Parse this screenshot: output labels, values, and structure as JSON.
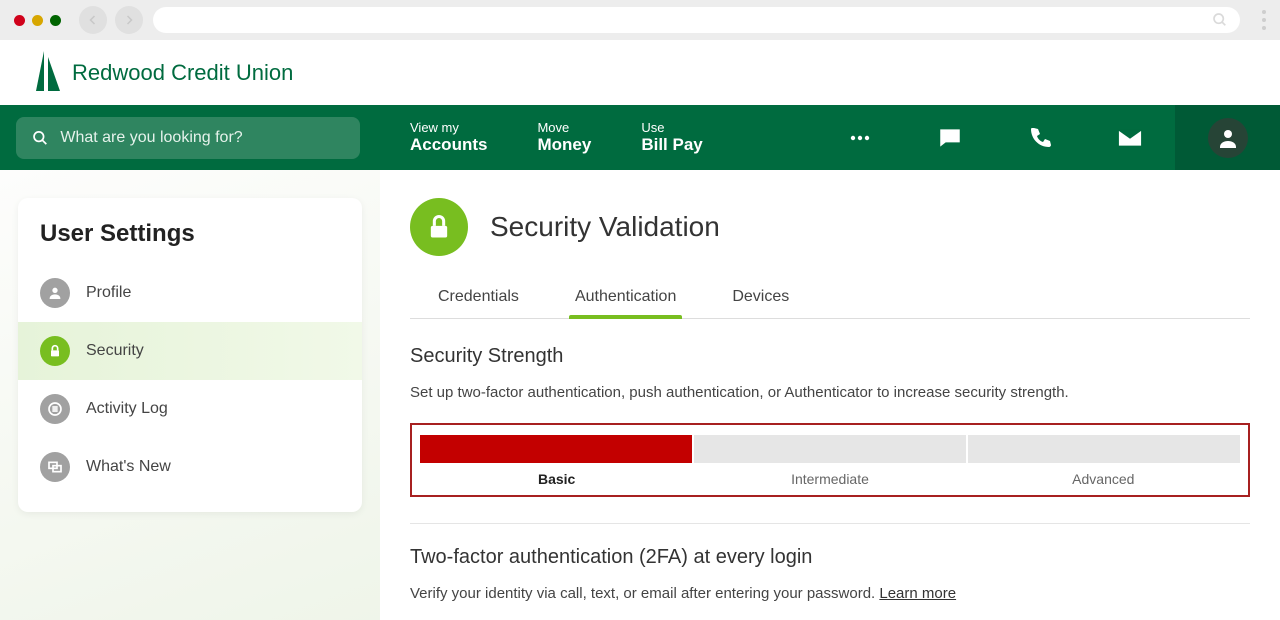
{
  "chrome": {
    "nav_back": "‹",
    "nav_fwd": "›"
  },
  "brand": {
    "name": "Redwood Credit Union"
  },
  "search": {
    "placeholder": "What are you looking for?"
  },
  "nav": {
    "items": [
      {
        "small": "View my",
        "big": "Accounts"
      },
      {
        "small": "Move",
        "big": "Money"
      },
      {
        "small": "Use",
        "big": "Bill Pay"
      }
    ]
  },
  "sidebar": {
    "title": "User Settings",
    "items": [
      {
        "label": "Profile"
      },
      {
        "label": "Security"
      },
      {
        "label": "Activity Log"
      },
      {
        "label": "What's New"
      }
    ]
  },
  "page": {
    "title": "Security Validation",
    "tabs": [
      {
        "label": "Credentials"
      },
      {
        "label": "Authentication"
      },
      {
        "label": "Devices"
      }
    ],
    "strength": {
      "heading": "Security Strength",
      "body": "Set up two-factor authentication, push authentication, or Authenticator to increase security strength.",
      "levels": [
        "Basic",
        "Intermediate",
        "Advanced"
      ]
    },
    "twofa": {
      "heading": "Two-factor authentication (2FA) at every login",
      "body": "Verify your identity via call, text, or email after entering your password. ",
      "link": "Learn more"
    }
  }
}
